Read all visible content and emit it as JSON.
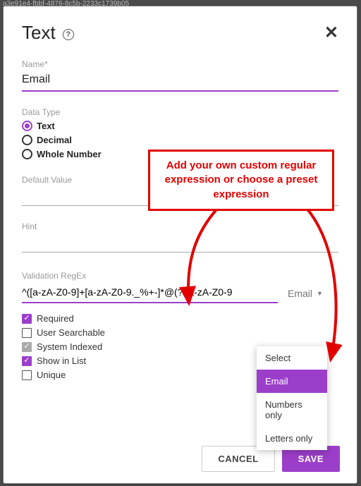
{
  "tabRemnant": "a3e91e4-fbbf-4876-8c5b-2233c1739b05",
  "header": {
    "title": "Text",
    "help": "?",
    "close": "✕"
  },
  "fields": {
    "nameLabel": "Name*",
    "nameValue": "Email",
    "dataTypeLabel": "Data Type",
    "dataTypeOptions": {
      "text": "Text",
      "decimal": "Decimal",
      "whole": "Whole Number"
    },
    "defaultValueLabel": "Default Value",
    "defaultValue": "",
    "hintLabel": "Hint",
    "hintValue": "",
    "regexLabel": "Validation RegEx",
    "regexValue": "^([a-zA-Z0-9]+[a-zA-Z0-9._%+-]*@(?:[a-zA-Z0-9",
    "preset": {
      "trigger": "Email",
      "caret": "▼",
      "options": {
        "select": "Select",
        "email": "Email",
        "numbers": "Numbers only",
        "letters": "Letters only"
      }
    }
  },
  "checks": {
    "required": "Required",
    "userSearchable": "User Searchable",
    "systemIndexed": "System Indexed",
    "showInList": "Show in List",
    "unique": "Unique"
  },
  "callout": "Add your own custom regular expression or choose a preset expression",
  "footer": {
    "cancel": "CANCEL",
    "save": "SAVE"
  }
}
